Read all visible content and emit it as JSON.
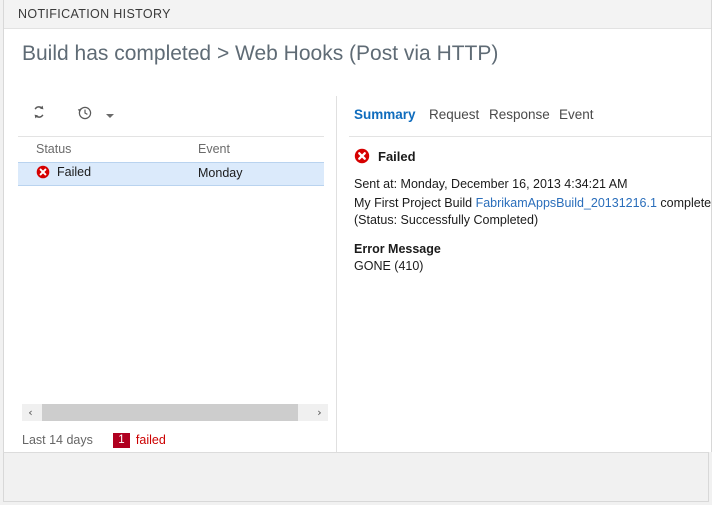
{
  "window": {
    "titlebar": "NOTIFICATION HISTORY",
    "page_title": "Build has completed > Web Hooks (Post via HTTP)"
  },
  "toolbar": {
    "refresh_icon": "refresh-icon",
    "history_icon": "history-clock-icon",
    "caret_icon": "chevron-down-icon"
  },
  "table": {
    "columns": [
      "Status",
      "Event"
    ],
    "rows": [
      {
        "status": "Failed",
        "status_icon": "error-circle-x-icon",
        "event": "Monday"
      }
    ]
  },
  "scrollbar": {
    "left_arrow": "‹",
    "right_arrow": "›"
  },
  "footer": {
    "range": "Last 14 days",
    "fail_count": "1",
    "fail_label": "failed"
  },
  "tabs": [
    {
      "label": "Summary",
      "active": true
    },
    {
      "label": "Request",
      "active": false
    },
    {
      "label": "Response",
      "active": false
    },
    {
      "label": "Event",
      "active": false
    }
  ],
  "detail": {
    "status_icon": "error-circle-x-icon",
    "status_text": "Failed",
    "sent_at": "Sent at: Monday, December 16, 2013 4:34:21 AM",
    "body_prefix": "My First Project Build ",
    "body_link": "FabrikamAppsBuild_20131216.1",
    "body_suffix": " completed (Status: Successfully Completed)",
    "error_heading": "Error Message",
    "error_message": "GONE (410)"
  },
  "colors": {
    "accent": "#0f6cbd",
    "link": "#2a6ebb",
    "error_red": "#cc0000",
    "badge_red": "#b00020",
    "selection": "#dbeafb",
    "title_gray": "#5f6b75"
  }
}
